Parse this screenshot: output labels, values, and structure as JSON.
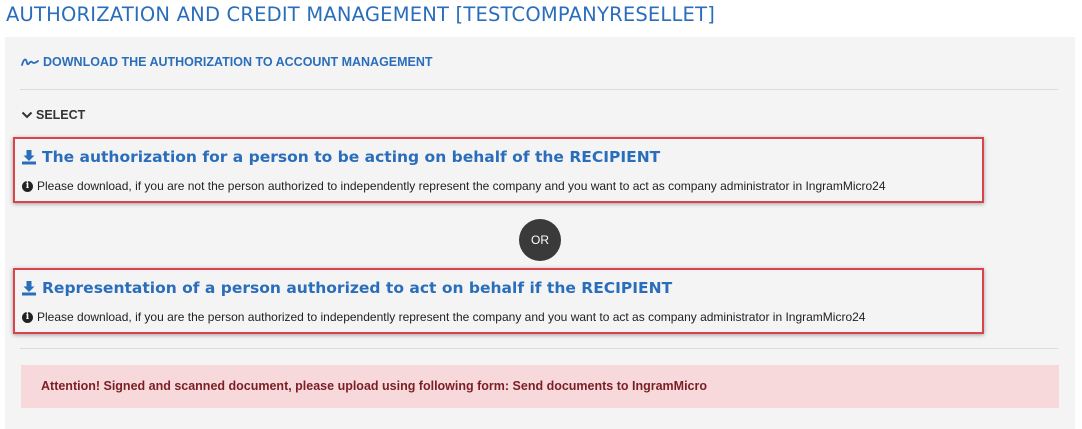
{
  "page": {
    "title": "AUTHORIZATION AND CREDIT MANAGEMENT [TESTCOMPANYRESELLET]"
  },
  "download_link": {
    "label": "DOWNLOAD THE AUTHORIZATION TO ACCOUNT MANAGEMENT",
    "icon": "signature-icon"
  },
  "select_toggle": {
    "label": "SELECT",
    "icon": "chevron-down-icon"
  },
  "options": [
    {
      "title": "The authorization for a person to be acting on behalf of the RECIPIENT",
      "info": "Please download, if you are not the person authorized to independently represent the company and you want to act as company administrator in IngramMicro24",
      "icon": "download-icon"
    },
    {
      "title": "Representation of a person authorized to act on behalf if the RECIPIENT",
      "info": "Please download, if you are the person authorized to independently represent the company and you want to act as company administrator in IngramMicro24",
      "icon": "download-icon"
    }
  ],
  "or_label": "OR",
  "attention": {
    "text": "Attention! Signed and scanned document, please upload using following form: Send documents to IngramMicro"
  },
  "colors": {
    "accent": "#2a6ebb",
    "highlight_border": "#d9434a",
    "attention_bg": "#f7d9db",
    "attention_text": "#7a1f25",
    "panel_bg": "#f4f4f4"
  }
}
